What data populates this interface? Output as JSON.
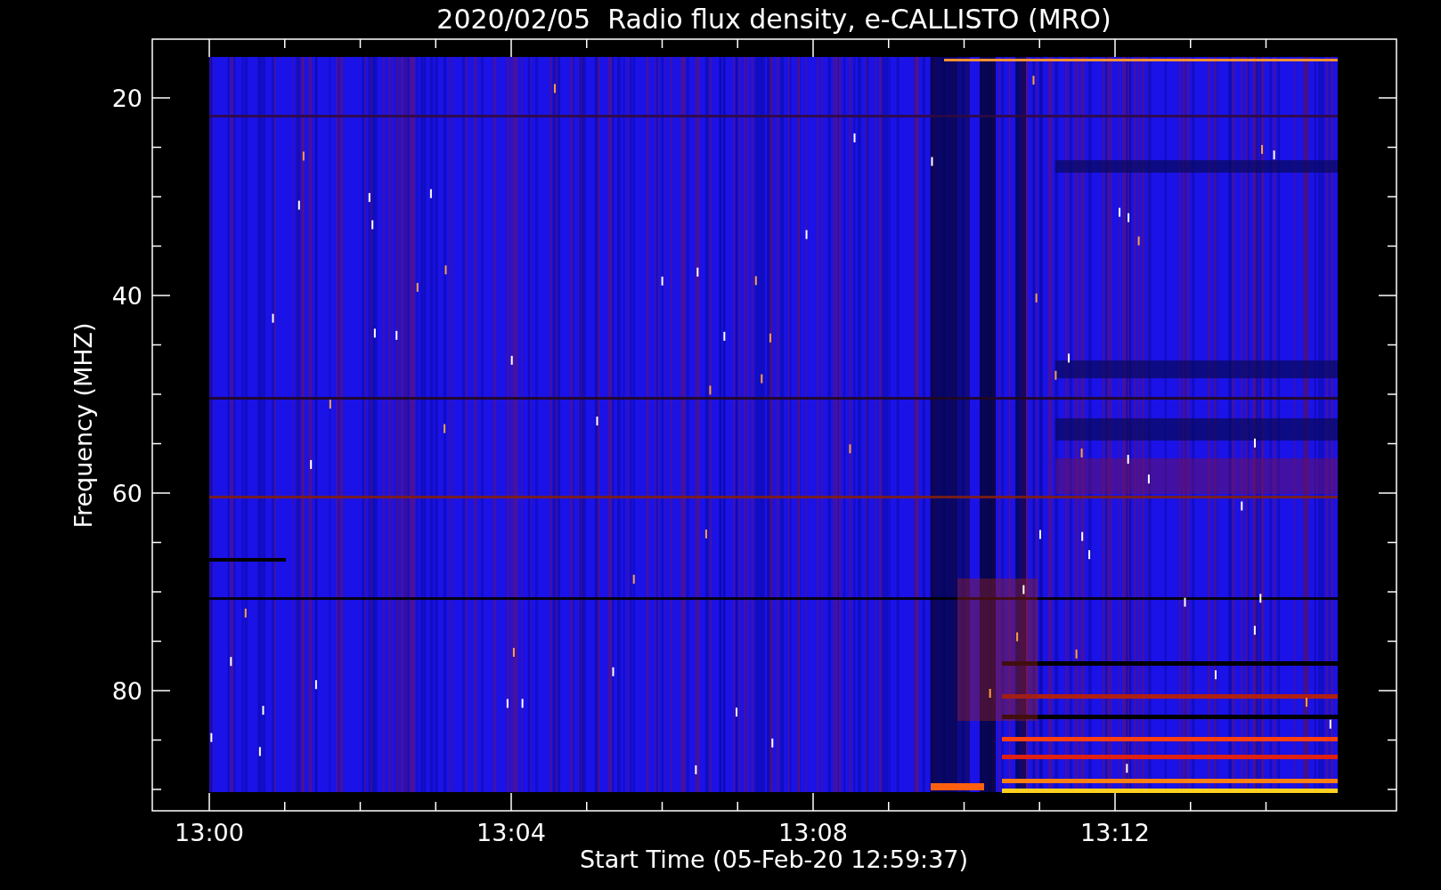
{
  "title": "2020/02/05  Radio flux density, e-CALLISTO (MRO)",
  "ylabel": "Frequency (MHZ)",
  "xlabel": "Start Time (05-Feb-20 12:59:37)",
  "yticks": [
    "20",
    "40",
    "60",
    "80"
  ],
  "xticks": [
    "13:00",
    "13:04",
    "13:08",
    "13:12"
  ]
}
